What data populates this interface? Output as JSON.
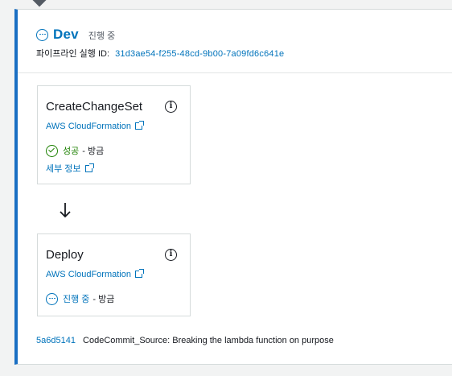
{
  "stage": {
    "name": "Dev",
    "status": "진행 중",
    "execution_label": "파이프라인 실행 ID:",
    "execution_id": "31d3ae54-f255-48cd-9b00-7a09fd6c641e"
  },
  "actions": [
    {
      "name": "CreateChangeSet",
      "provider": "AWS CloudFormation",
      "status": "성공",
      "time": "- 방금",
      "details_label": "세부 정보"
    },
    {
      "name": "Deploy",
      "provider": "AWS CloudFormation",
      "status": "진행 중",
      "time": "- 방금"
    }
  ],
  "commit": {
    "id": "5a6d5141",
    "message": "CodeCommit_Source: Breaking the lambda function on purpose"
  },
  "colors": {
    "accent": "#0073bb",
    "success": "#1d8102",
    "stage_border": "#1a6fc3"
  },
  "info_icon_glyph": "i"
}
